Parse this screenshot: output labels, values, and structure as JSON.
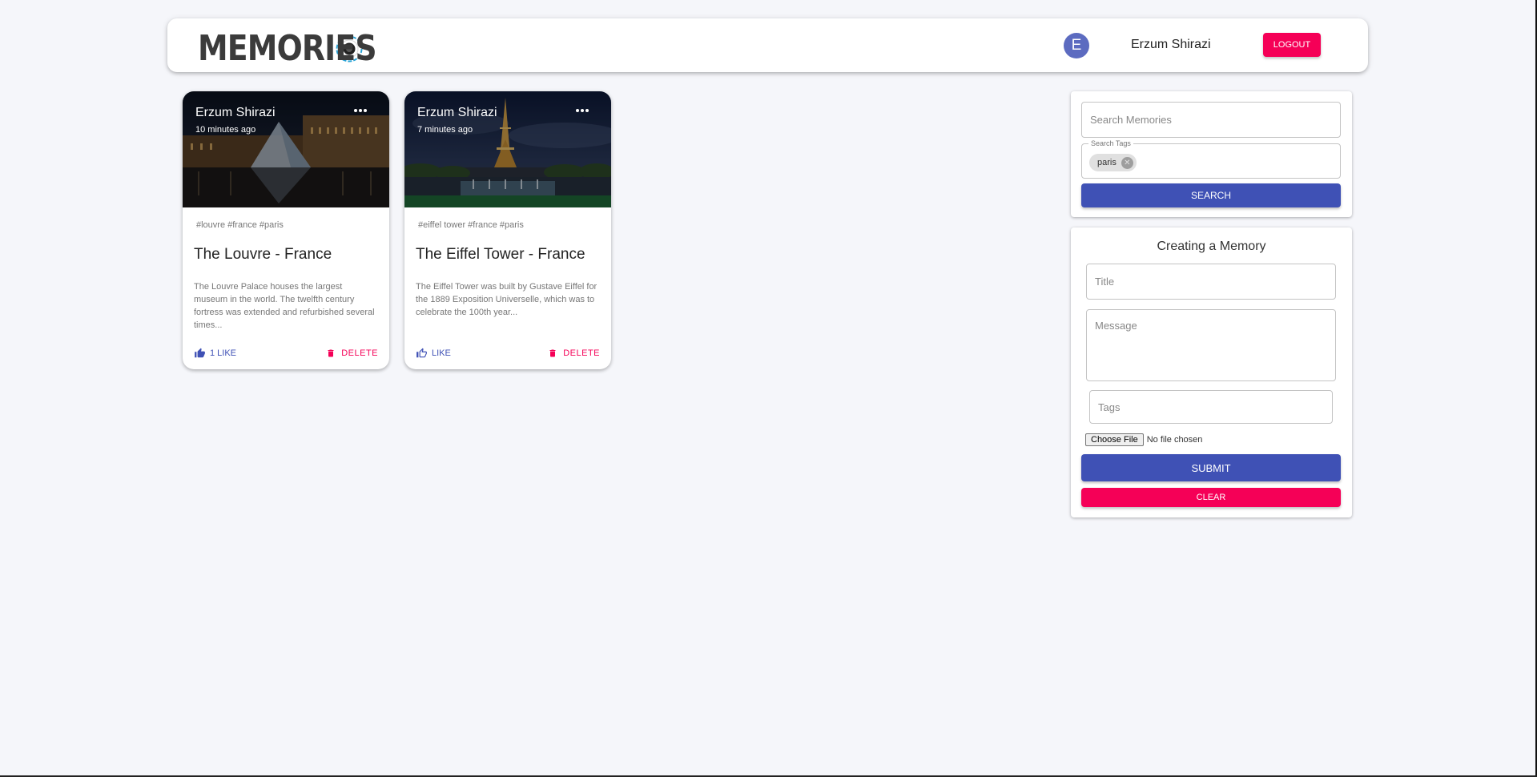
{
  "header": {
    "brand": "Memories",
    "avatar_letter": "E",
    "user_name": "Erzum Shirazi",
    "logout_label": "Logout"
  },
  "posts": [
    {
      "author": "Erzum Shirazi",
      "time": "10 minutes ago",
      "tags": "#louvre #france #paris",
      "title": "The Louvre - France",
      "message": "The Louvre Palace houses the largest museum in the world. The twelfth century fortress was extended and refurbished several times...",
      "like_label": "1 Like",
      "delete_label": "Delete"
    },
    {
      "author": "Erzum Shirazi",
      "time": "7 minutes ago",
      "tags": "#eiffel tower #france #paris",
      "title": "The Eiffel Tower - France",
      "message": "The Eiffel Tower was built by Gustave Eiffel for the 1889 Exposition Universelle, which was to celebrate the 100th year...",
      "like_label": "Like",
      "delete_label": "Delete"
    }
  ],
  "search": {
    "memories_placeholder": "Search Memories",
    "tags_legend": "Search Tags",
    "chip": "paris",
    "button": "Search"
  },
  "form": {
    "heading": "Creating a Memory",
    "title_placeholder": "Title",
    "message_placeholder": "Message",
    "tags_placeholder": "Tags",
    "file_button": "Choose File",
    "file_status": "No file chosen",
    "submit": "Submit",
    "clear": "Clear"
  },
  "colors": {
    "primary": "#3f51b5",
    "secondary": "#f50057",
    "avatar": "#5c6bc0",
    "background": "#f5f6fa"
  }
}
